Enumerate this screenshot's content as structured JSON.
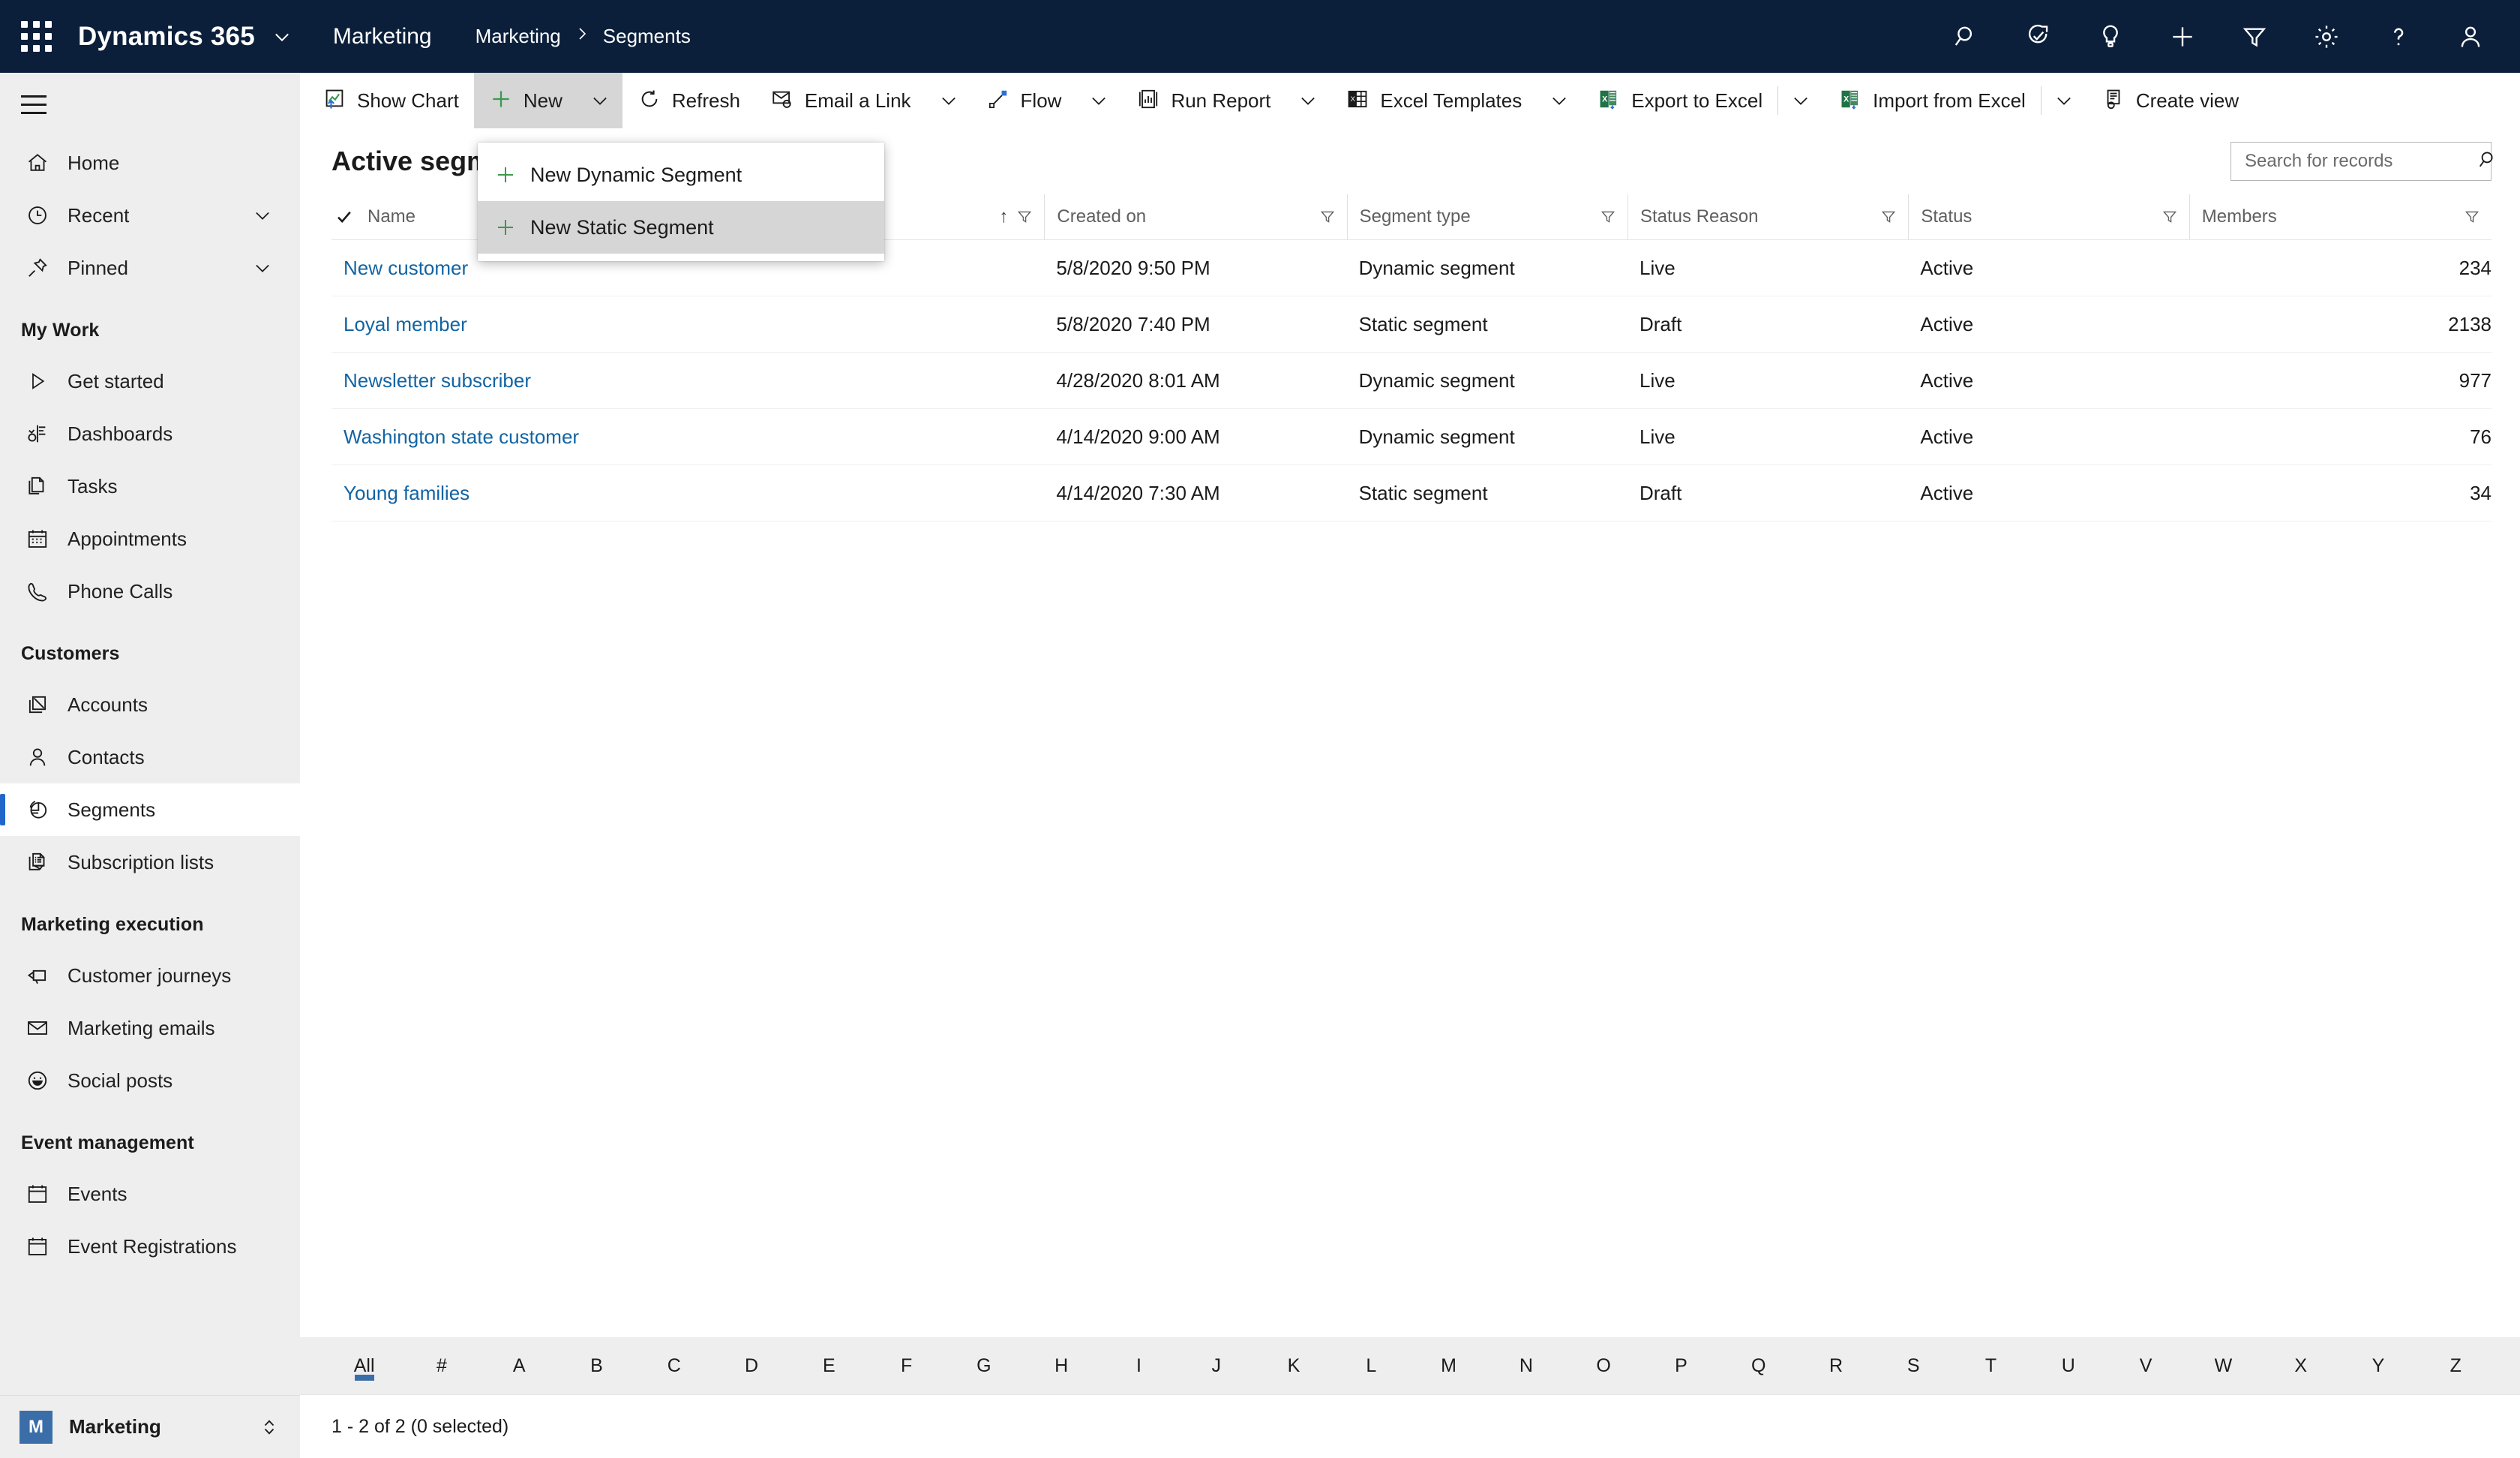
{
  "topbar": {
    "waffle_icon": "app-launcher-icon",
    "brand": "Dynamics 365",
    "brand_caret_icon": "chevron-down-icon",
    "app_name": "Marketing",
    "breadcrumb": [
      "Marketing",
      "Segments"
    ],
    "breadcrumb_separator": "›",
    "right_icons": [
      {
        "name": "search-icon"
      },
      {
        "name": "relevance-search-assist-icon"
      },
      {
        "name": "lightbulb-icon"
      },
      {
        "name": "quick-create-icon"
      },
      {
        "name": "filter-icon"
      },
      {
        "name": "settings-gear-icon"
      },
      {
        "name": "help-icon"
      },
      {
        "name": "user-account-icon"
      }
    ]
  },
  "sidebar": {
    "hamburger_icon": "hamburger-menu-icon",
    "top_items": [
      {
        "label": "Home",
        "icon": "home-icon",
        "chevron": false
      },
      {
        "label": "Recent",
        "icon": "clock-icon",
        "chevron": true
      },
      {
        "label": "Pinned",
        "icon": "pin-icon",
        "chevron": true
      }
    ],
    "groups": [
      {
        "title": "My Work",
        "items": [
          {
            "label": "Get started",
            "icon": "play-triangle-icon"
          },
          {
            "label": "Dashboards",
            "icon": "dashboard-icon"
          },
          {
            "label": "Tasks",
            "icon": "tasks-icon"
          },
          {
            "label": "Appointments",
            "icon": "calendar-icon"
          },
          {
            "label": "Phone Calls",
            "icon": "phone-icon"
          }
        ]
      },
      {
        "title": "Customers",
        "items": [
          {
            "label": "Accounts",
            "icon": "accounts-icon"
          },
          {
            "label": "Contacts",
            "icon": "contact-person-icon"
          },
          {
            "label": "Segments",
            "icon": "pie-chart-icon",
            "selected": true
          },
          {
            "label": "Subscription lists",
            "icon": "subscription-list-icon"
          }
        ]
      },
      {
        "title": "Marketing execution",
        "items": [
          {
            "label": "Customer journeys",
            "icon": "megaphone-icon"
          },
          {
            "label": "Marketing emails",
            "icon": "envelope-icon"
          },
          {
            "label": "Social posts",
            "icon": "smiley-icon"
          }
        ]
      },
      {
        "title": "Event management",
        "items": [
          {
            "label": "Events",
            "icon": "calendar-blank-icon"
          },
          {
            "label": "Event Registrations",
            "icon": "calendar-blank-icon"
          }
        ]
      }
    ],
    "app_switcher": {
      "tile_letter": "M",
      "label": "Marketing",
      "updown_icon": "up-down-chevron-icon"
    }
  },
  "commandbar": {
    "items": [
      {
        "label": "Show Chart",
        "icon": "show-chart-icon",
        "caret": false,
        "active": false
      },
      {
        "label": "New",
        "icon": "plus-green-icon",
        "caret": true,
        "active": true
      },
      {
        "label": "Refresh",
        "icon": "refresh-icon",
        "caret": false,
        "active": false
      },
      {
        "label": "Email a Link",
        "icon": "email-link-icon",
        "caret": true,
        "active": false
      },
      {
        "label": "Flow",
        "icon": "flow-icon",
        "caret": true,
        "active": false
      },
      {
        "label": "Run Report",
        "icon": "run-report-icon",
        "caret": true,
        "active": false
      },
      {
        "label": "Excel Templates",
        "icon": "excel-templates-icon",
        "caret": true,
        "active": false
      },
      {
        "label": "Export to Excel",
        "icon": "excel-icon",
        "caret": true,
        "active": false
      },
      {
        "label": "Import from Excel",
        "icon": "excel-icon",
        "caret": true,
        "active": false
      },
      {
        "label": "Create view",
        "icon": "create-view-icon",
        "caret": false,
        "active": false
      }
    ]
  },
  "new_menu": {
    "items": [
      {
        "label": "New Dynamic Segment",
        "icon": "plus-green-icon",
        "hovered": false
      },
      {
        "label": "New Static Segment",
        "icon": "plus-green-icon",
        "hovered": true
      }
    ]
  },
  "view": {
    "title": "Active segments",
    "search_placeholder": "Search for records",
    "search_value": "",
    "search_icon": "search-icon"
  },
  "grid": {
    "select_all_icon": "checkmark-icon",
    "columns": [
      {
        "label": "Name",
        "sort": "ascending",
        "sort_icon": "arrow-up-icon",
        "filter_icon": "filter-icon",
        "align": "left"
      },
      {
        "label": "Created on",
        "sort": "none",
        "filter_icon": "filter-icon",
        "align": "left"
      },
      {
        "label": "Segment type",
        "sort": "none",
        "filter_icon": "filter-icon",
        "align": "left"
      },
      {
        "label": "Status Reason",
        "sort": "none",
        "filter_icon": "filter-icon",
        "align": "left"
      },
      {
        "label": "Status",
        "sort": "none",
        "filter_icon": "filter-icon",
        "align": "left"
      },
      {
        "label": "Members",
        "sort": "none",
        "filter_icon": "filter-icon",
        "align": "right"
      }
    ],
    "rows": [
      {
        "name": "New customer",
        "created_on": "5/8/2020 9:50 PM",
        "segment_type": "Dynamic segment",
        "status_reason": "Live",
        "status": "Active",
        "members": "234"
      },
      {
        "name": "Loyal member",
        "created_on": "5/8/2020 7:40 PM",
        "segment_type": "Static segment",
        "status_reason": "Draft",
        "status": "Active",
        "members": "2138"
      },
      {
        "name": "Newsletter subscriber",
        "created_on": "4/28/2020 8:01 AM",
        "segment_type": "Dynamic segment",
        "status_reason": "Live",
        "status": "Active",
        "members": "977"
      },
      {
        "name": "Washington state customer",
        "created_on": "4/14/2020 9:00 AM",
        "segment_type": "Dynamic segment",
        "status_reason": "Live",
        "status": "Active",
        "members": "76"
      },
      {
        "name": "Young families",
        "created_on": "4/14/2020 7:30 AM",
        "segment_type": "Static segment",
        "status_reason": "Draft",
        "status": "Active",
        "members": "34"
      }
    ]
  },
  "alphabar": {
    "selected": "All",
    "letters": [
      "All",
      "#",
      "A",
      "B",
      "C",
      "D",
      "E",
      "F",
      "G",
      "H",
      "I",
      "J",
      "K",
      "L",
      "M",
      "N",
      "O",
      "P",
      "Q",
      "R",
      "S",
      "T",
      "U",
      "V",
      "W",
      "X",
      "Y",
      "Z"
    ]
  },
  "footer": {
    "record_count": "1 - 2 of 2 (0 selected)"
  },
  "colors": {
    "topbar_bg": "#0b1f3a",
    "sidebar_bg": "#efeeee",
    "accent_blue": "#2266cc",
    "link_blue": "#1264a3",
    "green_plus": "#3a9a4f",
    "excel_green": "#217346",
    "app_tile_blue": "#3b6ea8"
  }
}
